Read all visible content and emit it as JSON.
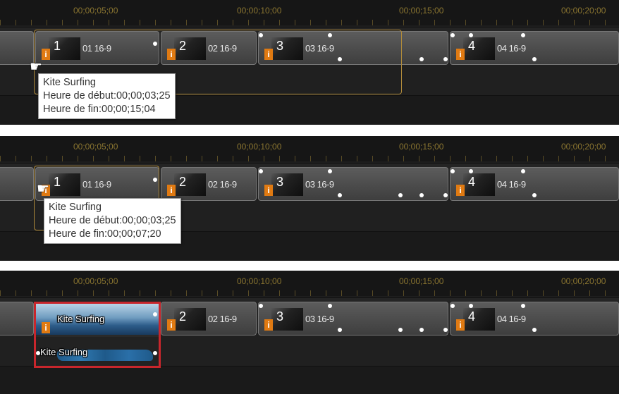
{
  "ruler_labels": [
    "00;00;05;00",
    "00;00;10;00",
    "00;00;15;00",
    "00;00;20;00"
  ],
  "clips": [
    {
      "number": "1",
      "name": "01 16-9"
    },
    {
      "number": "2",
      "name": "02 16-9"
    },
    {
      "number": "3",
      "name": "03 16-9"
    },
    {
      "number": "4",
      "name": "04 16-9"
    }
  ],
  "info_badge": "i",
  "cursor_glyph": "☛",
  "panel1": {
    "tooltip": {
      "title": "Kite Surfing",
      "start": "Heure de début:00;00;03;25",
      "end": "Heure de fin:00;00;15;04"
    }
  },
  "panel2": {
    "tooltip": {
      "title": "Kite Surfing",
      "start": "Heure de début:00;00;03;25",
      "end": "Heure de fin:00;00;07;20"
    }
  },
  "panel3": {
    "video_label": "Kite Surfing",
    "audio_label": "Kite Surfing"
  },
  "colors": {
    "selection_outline": "#b08a3a",
    "selected_clip_border": "#c8262c",
    "ruler_text": "#8a7530",
    "info_badge": "#e07a12"
  }
}
